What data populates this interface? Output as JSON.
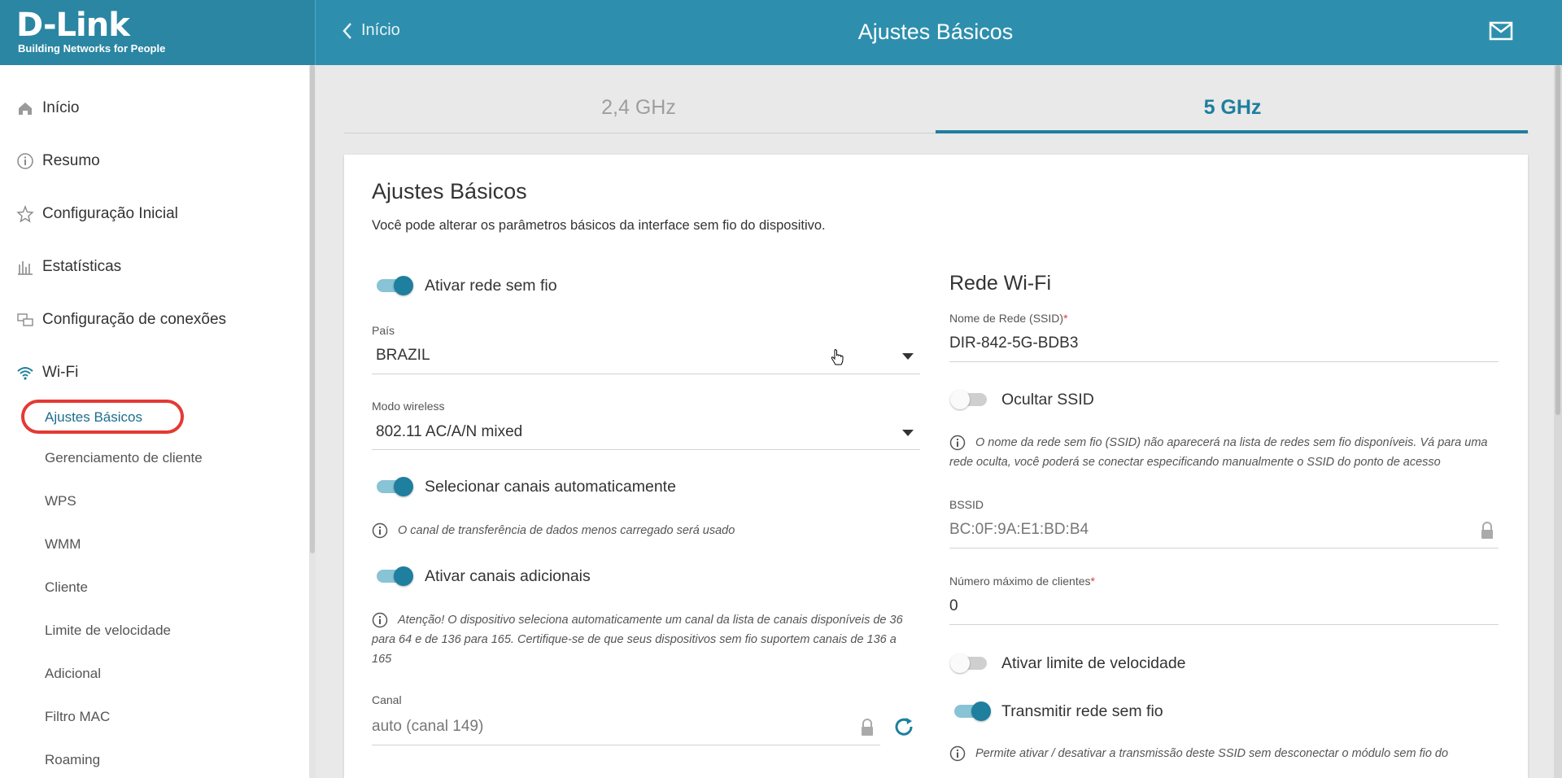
{
  "header": {
    "logo": "D-Link",
    "logo_tagline": "Building Networks for People",
    "back_label": "Início",
    "title": "Ajustes Básicos"
  },
  "sidebar": {
    "items": [
      {
        "label": "Início",
        "icon": "home-icon"
      },
      {
        "label": "Resumo",
        "icon": "info-icon"
      },
      {
        "label": "Configuração Inicial",
        "icon": "star-icon"
      },
      {
        "label": "Estatísticas",
        "icon": "bar-chart-icon"
      },
      {
        "label": "Configuração de conexões",
        "icon": "connections-icon"
      },
      {
        "label": "Wi-Fi",
        "icon": "wifi-icon"
      }
    ],
    "wifi_sub": [
      "Ajustes Básicos",
      "Gerenciamento de cliente",
      "WPS",
      "WMM",
      "Cliente",
      "Limite de velocidade",
      "Adicional",
      "Filtro MAC",
      "Roaming"
    ],
    "active_sub": "Ajustes Básicos"
  },
  "tabs": [
    "2,4 GHz",
    "5 GHz"
  ],
  "active_tab": "5 GHz",
  "card": {
    "title": "Ajustes Básicos",
    "description": "Você pode alterar os parâmetros básicos da interface sem fio do dispositivo."
  },
  "left": {
    "enable_wireless": {
      "label": "Ativar rede sem fio",
      "on": true
    },
    "country": {
      "label": "País",
      "value": "BRAZIL"
    },
    "wireless_mode": {
      "label": "Modo wireless",
      "value": "802.11 AC/A/N mixed"
    },
    "auto_channel": {
      "label": "Selecionar canais automaticamente",
      "on": true,
      "info": "O canal de transferência de dados menos carregado será usado"
    },
    "extra_channels": {
      "label": "Ativar canais adicionais",
      "on": true,
      "info_line1": "Atenção! O dispositivo seleciona automaticamente um canal da lista de canais disponíveis de 36",
      "info_line2": "para 64 e de 136 para 165. Certifique-se de que seus dispositivos sem fio suportem canais de 136 a",
      "info_line3": "165"
    },
    "channel": {
      "label": "Canal",
      "value": "auto (canal 149)"
    }
  },
  "right": {
    "section_title": "Rede Wi-Fi",
    "ssid": {
      "label": "Nome de Rede (SSID)",
      "required": "*",
      "value": "DIR-842-5G-BDB3"
    },
    "hide_ssid": {
      "label": "Ocultar SSID",
      "on": false,
      "info_line1": "O nome da rede sem fio (SSID) não aparecerá na lista de redes sem fio disponíveis. Vá para uma",
      "info_line2": "rede oculta, você poderá se conectar especificando manualmente o SSID do ponto de acesso"
    },
    "bssid": {
      "label": "BSSID",
      "value": "BC:0F:9A:E1:BD:B4"
    },
    "max_clients": {
      "label": "Número máximo de clientes",
      "required": "*",
      "value": "0"
    },
    "speed_limit": {
      "label": "Ativar limite de velocidade",
      "on": false
    },
    "broadcast": {
      "label": "Transmitir rede sem fio",
      "on": true,
      "info": "Permite ativar / desativar a transmissão deste SSID sem desconectar o módulo sem fio do"
    }
  },
  "colors": {
    "accent": "#1e7f9e",
    "header": "#2d8fad",
    "highlight": "#e53935"
  }
}
